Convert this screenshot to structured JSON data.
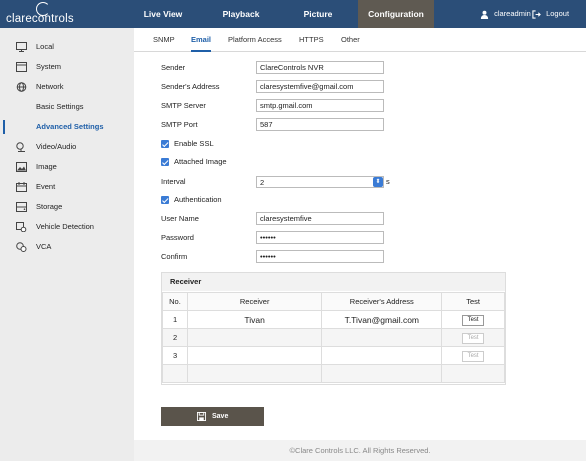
{
  "brand": {
    "logo_text": "clarecontrols"
  },
  "topnav": [
    {
      "label": "Live View",
      "active": false
    },
    {
      "label": "Playback",
      "active": false
    },
    {
      "label": "Picture",
      "active": false
    },
    {
      "label": "Configuration",
      "active": true
    }
  ],
  "user": {
    "name": "clareadmin",
    "logout": "Logout"
  },
  "sidebar": {
    "items": [
      {
        "label": "Local",
        "icon": "monitor-icon"
      },
      {
        "label": "System",
        "icon": "system-icon"
      },
      {
        "label": "Network",
        "icon": "globe-icon"
      },
      {
        "label": "Basic Settings",
        "icon": ""
      },
      {
        "label": "Advanced Settings",
        "icon": "",
        "active": true
      },
      {
        "label": "Video/Audio",
        "icon": "camera-icon"
      },
      {
        "label": "Image",
        "icon": "image-icon"
      },
      {
        "label": "Event",
        "icon": "calendar-icon"
      },
      {
        "label": "Storage",
        "icon": "storage-icon"
      },
      {
        "label": "Vehicle Detection",
        "icon": "vehicle-icon"
      },
      {
        "label": "VCA",
        "icon": "vca-icon"
      }
    ]
  },
  "tabs": [
    {
      "label": "SNMP",
      "active": false
    },
    {
      "label": "Email",
      "active": true
    },
    {
      "label": "Platform Access",
      "active": false
    },
    {
      "label": "HTTPS",
      "active": false
    },
    {
      "label": "Other",
      "active": false
    }
  ],
  "form": {
    "sender_label": "Sender",
    "sender_value": "ClareControls NVR",
    "sender_address_label": "Sender's Address",
    "sender_address_value": "claresystemfive@gmail.com",
    "smtp_server_label": "SMTP Server",
    "smtp_server_value": "smtp.gmail.com",
    "smtp_port_label": "SMTP Port",
    "smtp_port_value": "587",
    "enable_ssl_label": "Enable SSL",
    "attached_image_label": "Attached Image",
    "interval_label": "Interval",
    "interval_value": "2",
    "interval_unit": "s",
    "authentication_label": "Authentication",
    "username_label": "User Name",
    "username_value": "claresystemfive",
    "password_label": "Password",
    "password_value": "••••••",
    "confirm_label": "Confirm",
    "confirm_value": "••••••"
  },
  "receiver": {
    "title": "Receiver",
    "columns": [
      "No.",
      "Receiver",
      "Receiver's Address",
      "Test"
    ],
    "rows": [
      {
        "no": "1",
        "receiver": "Tivan",
        "address": "T.Tivan@gmail.com",
        "test": "Test",
        "enabled": true
      },
      {
        "no": "2",
        "receiver": "",
        "address": "",
        "test": "Test",
        "enabled": false
      },
      {
        "no": "3",
        "receiver": "",
        "address": "",
        "test": "Test",
        "enabled": false
      }
    ]
  },
  "save_label": "Save",
  "footer": "©Clare Controls LLC. All Rights Reserved."
}
